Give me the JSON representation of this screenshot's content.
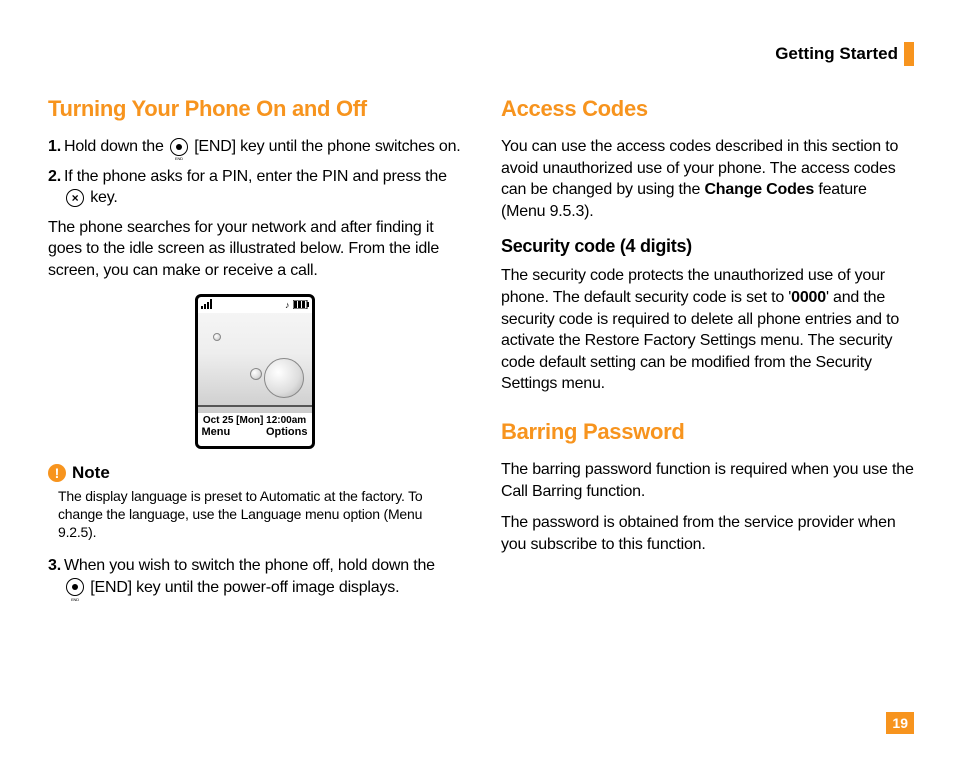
{
  "header": {
    "section": "Getting Started"
  },
  "left": {
    "h_turning": "Turning Your Phone On and Off",
    "step1_num": "1.",
    "step1_a": "Hold down the ",
    "step1_b": " [END] key until the phone switches on.",
    "step2_num": "2.",
    "step2_a": "If the phone asks for a PIN, enter the PIN and press the ",
    "step2_b": " key.",
    "para_search": "The phone searches for your network and after finding it goes to the idle screen as illustrated below. From the idle screen, you can make or receive a call.",
    "phone": {
      "datetime": "Oct 25 [Mon] 12:00am",
      "soft_left": "Menu",
      "soft_right": "Options"
    },
    "note_label": "Note",
    "note_body": "The display language is preset to Automatic at the factory. To change the language, use the Language menu option (Menu 9.2.5).",
    "step3_num": "3.",
    "step3_a": "When you wish to switch the phone off, hold down the ",
    "step3_b": " [END] key until the power-off image displays."
  },
  "right": {
    "h_access": "Access Codes",
    "para_access_a": "You can use the access codes described in this section to avoid unauthorized use of your phone. The access codes can be changed by using the ",
    "para_access_bold": "Change Codes",
    "para_access_b": " feature (Menu 9.5.3).",
    "h_security": "Security code (4 digits)",
    "para_security_a": "The security code protects the unauthorized use of your phone. The default security code is set to '",
    "para_security_bold": "0000",
    "para_security_b": "' and the security code is required to delete all phone entries and to activate the Restore Factory Settings menu. The security code default setting can be modified from the Security Settings menu.",
    "h_barring": "Barring Password",
    "para_barring1": "The barring password function is required when you use the Call Barring function.",
    "para_barring2": "The password is obtained from the service provider when you subscribe to this function."
  },
  "page_number": "19"
}
